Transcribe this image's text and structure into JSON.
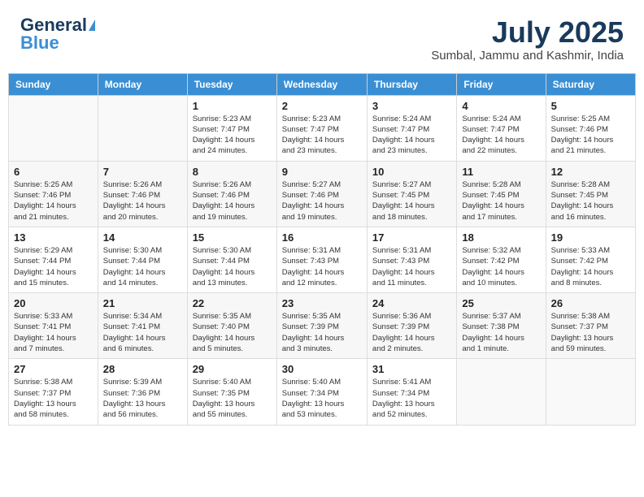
{
  "header": {
    "logo_line1": "General",
    "logo_line2": "Blue",
    "month": "July 2025",
    "location": "Sumbal, Jammu and Kashmir, India"
  },
  "weekdays": [
    "Sunday",
    "Monday",
    "Tuesday",
    "Wednesday",
    "Thursday",
    "Friday",
    "Saturday"
  ],
  "weeks": [
    [
      {
        "day": "",
        "info": ""
      },
      {
        "day": "",
        "info": ""
      },
      {
        "day": "1",
        "info": "Sunrise: 5:23 AM\nSunset: 7:47 PM\nDaylight: 14 hours\nand 24 minutes."
      },
      {
        "day": "2",
        "info": "Sunrise: 5:23 AM\nSunset: 7:47 PM\nDaylight: 14 hours\nand 23 minutes."
      },
      {
        "day": "3",
        "info": "Sunrise: 5:24 AM\nSunset: 7:47 PM\nDaylight: 14 hours\nand 23 minutes."
      },
      {
        "day": "4",
        "info": "Sunrise: 5:24 AM\nSunset: 7:47 PM\nDaylight: 14 hours\nand 22 minutes."
      },
      {
        "day": "5",
        "info": "Sunrise: 5:25 AM\nSunset: 7:46 PM\nDaylight: 14 hours\nand 21 minutes."
      }
    ],
    [
      {
        "day": "6",
        "info": "Sunrise: 5:25 AM\nSunset: 7:46 PM\nDaylight: 14 hours\nand 21 minutes."
      },
      {
        "day": "7",
        "info": "Sunrise: 5:26 AM\nSunset: 7:46 PM\nDaylight: 14 hours\nand 20 minutes."
      },
      {
        "day": "8",
        "info": "Sunrise: 5:26 AM\nSunset: 7:46 PM\nDaylight: 14 hours\nand 19 minutes."
      },
      {
        "day": "9",
        "info": "Sunrise: 5:27 AM\nSunset: 7:46 PM\nDaylight: 14 hours\nand 19 minutes."
      },
      {
        "day": "10",
        "info": "Sunrise: 5:27 AM\nSunset: 7:45 PM\nDaylight: 14 hours\nand 18 minutes."
      },
      {
        "day": "11",
        "info": "Sunrise: 5:28 AM\nSunset: 7:45 PM\nDaylight: 14 hours\nand 17 minutes."
      },
      {
        "day": "12",
        "info": "Sunrise: 5:28 AM\nSunset: 7:45 PM\nDaylight: 14 hours\nand 16 minutes."
      }
    ],
    [
      {
        "day": "13",
        "info": "Sunrise: 5:29 AM\nSunset: 7:44 PM\nDaylight: 14 hours\nand 15 minutes."
      },
      {
        "day": "14",
        "info": "Sunrise: 5:30 AM\nSunset: 7:44 PM\nDaylight: 14 hours\nand 14 minutes."
      },
      {
        "day": "15",
        "info": "Sunrise: 5:30 AM\nSunset: 7:44 PM\nDaylight: 14 hours\nand 13 minutes."
      },
      {
        "day": "16",
        "info": "Sunrise: 5:31 AM\nSunset: 7:43 PM\nDaylight: 14 hours\nand 12 minutes."
      },
      {
        "day": "17",
        "info": "Sunrise: 5:31 AM\nSunset: 7:43 PM\nDaylight: 14 hours\nand 11 minutes."
      },
      {
        "day": "18",
        "info": "Sunrise: 5:32 AM\nSunset: 7:42 PM\nDaylight: 14 hours\nand 10 minutes."
      },
      {
        "day": "19",
        "info": "Sunrise: 5:33 AM\nSunset: 7:42 PM\nDaylight: 14 hours\nand 8 minutes."
      }
    ],
    [
      {
        "day": "20",
        "info": "Sunrise: 5:33 AM\nSunset: 7:41 PM\nDaylight: 14 hours\nand 7 minutes."
      },
      {
        "day": "21",
        "info": "Sunrise: 5:34 AM\nSunset: 7:41 PM\nDaylight: 14 hours\nand 6 minutes."
      },
      {
        "day": "22",
        "info": "Sunrise: 5:35 AM\nSunset: 7:40 PM\nDaylight: 14 hours\nand 5 minutes."
      },
      {
        "day": "23",
        "info": "Sunrise: 5:35 AM\nSunset: 7:39 PM\nDaylight: 14 hours\nand 3 minutes."
      },
      {
        "day": "24",
        "info": "Sunrise: 5:36 AM\nSunset: 7:39 PM\nDaylight: 14 hours\nand 2 minutes."
      },
      {
        "day": "25",
        "info": "Sunrise: 5:37 AM\nSunset: 7:38 PM\nDaylight: 14 hours\nand 1 minute."
      },
      {
        "day": "26",
        "info": "Sunrise: 5:38 AM\nSunset: 7:37 PM\nDaylight: 13 hours\nand 59 minutes."
      }
    ],
    [
      {
        "day": "27",
        "info": "Sunrise: 5:38 AM\nSunset: 7:37 PM\nDaylight: 13 hours\nand 58 minutes."
      },
      {
        "day": "28",
        "info": "Sunrise: 5:39 AM\nSunset: 7:36 PM\nDaylight: 13 hours\nand 56 minutes."
      },
      {
        "day": "29",
        "info": "Sunrise: 5:40 AM\nSunset: 7:35 PM\nDaylight: 13 hours\nand 55 minutes."
      },
      {
        "day": "30",
        "info": "Sunrise: 5:40 AM\nSunset: 7:34 PM\nDaylight: 13 hours\nand 53 minutes."
      },
      {
        "day": "31",
        "info": "Sunrise: 5:41 AM\nSunset: 7:34 PM\nDaylight: 13 hours\nand 52 minutes."
      },
      {
        "day": "",
        "info": ""
      },
      {
        "day": "",
        "info": ""
      }
    ]
  ]
}
